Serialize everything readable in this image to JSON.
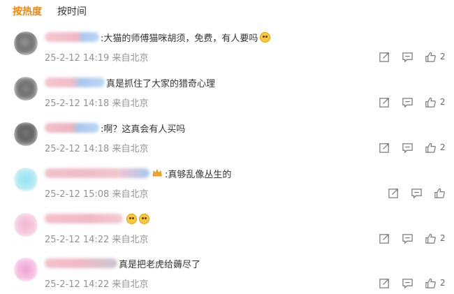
{
  "tabs": [
    {
      "label": "按热度"
    },
    {
      "label": "按时间"
    }
  ],
  "comments": [
    {
      "text": ":大猫的师傅猫咪胡须，免费，有人要吗",
      "time": "25-2-12 14:19 来自北京",
      "likes": "2"
    },
    {
      "text": "真是抓住了大家的猎奇心理",
      "time": "25-2-12 14:18 来自北京",
      "likes": "2"
    },
    {
      "text": ":啊？这真会有人买吗",
      "time": "25-2-12 14:18 来自北京",
      "likes": "2"
    },
    {
      "text": ":真够乱像丛生的",
      "time": "25-2-12 15:08 来自北京",
      "likes": ""
    },
    {
      "text": "",
      "time": "25-2-12 14:22 来自北京",
      "likes": "2"
    },
    {
      "text": "真是把老虎给薅尽了",
      "time": "25-2-12 14:22 来自北京",
      "likes": "2"
    }
  ],
  "icons": {
    "share": "share-icon",
    "comment": "comment-icon",
    "like": "like-icon"
  },
  "colors": {
    "accent": "#ff8200",
    "meta": "#939393",
    "icon": "#7a7a7a"
  }
}
